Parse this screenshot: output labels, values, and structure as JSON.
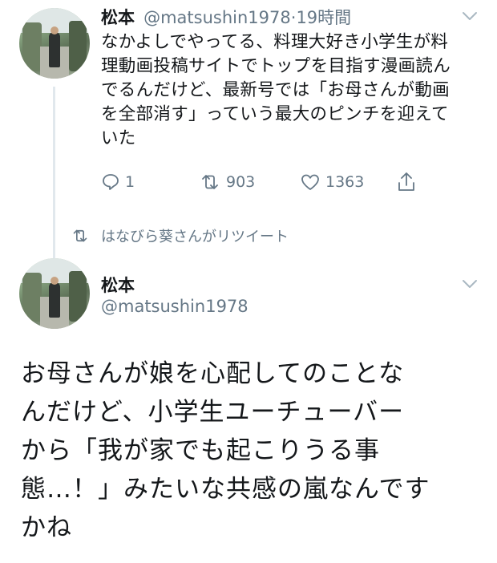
{
  "tweet1": {
    "author_name": "松本",
    "handle": "@matsushin1978",
    "separator": "·",
    "time": "19時間",
    "text_lines": [
      "なかよしでやってる、料理大好き小学生が料",
      "理動画投稿サイトでトップを目指す漫画読ん",
      "でるんだけど、最新号では「お母さんが動画",
      "を全部消す」っていう最大のピンチを迎えて",
      "いた"
    ],
    "actions": {
      "reply_count": "1",
      "retweet_count": "903",
      "like_count": "1363"
    },
    "icons": [
      "reply-icon",
      "retweet-icon",
      "like-icon",
      "share-icon",
      "chevron-down-icon"
    ]
  },
  "retweet_context": {
    "label": "はなびら葵さんがリツイート",
    "icon": "retweet-icon"
  },
  "tweet2": {
    "author_name": "松本",
    "handle": "@matsushin1978",
    "text_lines": [
      "お母さんが娘を心配してのことな",
      "んだけど、小学生ユーチューバー",
      "から「我が家でも起こりうる事",
      "態…！」みたいな共感の嵐なんです",
      "かね"
    ],
    "icons": [
      "chevron-down-icon"
    ]
  },
  "colors": {
    "text": "#14171a",
    "secondary": "#657786",
    "divider": "#e1e8ed",
    "chevron": "#aab8c2"
  }
}
